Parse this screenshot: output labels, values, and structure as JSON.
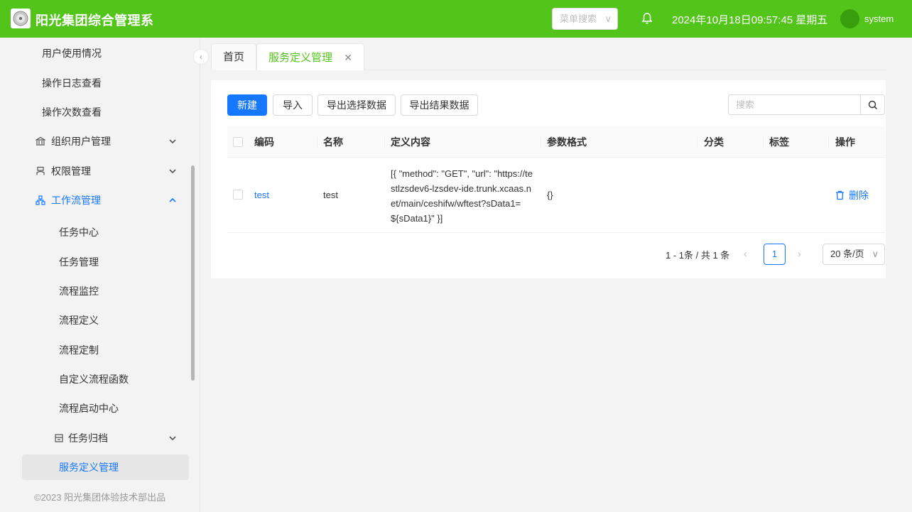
{
  "header": {
    "title": "阳光集团综合管理系",
    "menu_search_placeholder": "菜单搜索",
    "datetime": "2024年10月18日09:57:45 星期五",
    "username": "system",
    "accent": "#52c41a"
  },
  "sidebar": {
    "items": [
      {
        "label": "用户使用情况"
      },
      {
        "label": "操作日志查看"
      },
      {
        "label": "操作次数查看"
      },
      {
        "label": "组织用户管理",
        "icon": "bank-icon"
      },
      {
        "label": "权限管理",
        "icon": "user-icon"
      },
      {
        "label": "工作流管理",
        "icon": "cluster-icon"
      },
      {
        "label": "任务中心"
      },
      {
        "label": "任务管理"
      },
      {
        "label": "流程监控"
      },
      {
        "label": "流程定义"
      },
      {
        "label": "流程定制"
      },
      {
        "label": "自定义流程函数"
      },
      {
        "label": "流程启动中心"
      },
      {
        "label": "任务归档",
        "icon": "archive-icon"
      },
      {
        "label": "服务定义管理"
      }
    ],
    "copyright": "©2023 阳光集团体验技术部出品"
  },
  "tabs": [
    {
      "label": "首页"
    },
    {
      "label": "服务定义管理"
    }
  ],
  "toolbar": {
    "new_label": "新建",
    "import_label": "导入",
    "export_selected_label": "导出选择数据",
    "export_result_label": "导出结果数据",
    "search_placeholder": "搜索"
  },
  "table": {
    "columns": [
      "编码",
      "名称",
      "定义内容",
      "参数格式",
      "分类",
      "标签",
      "操作"
    ],
    "rows": [
      {
        "code": "test",
        "name": "test",
        "definition": "[{ \"method\": \"GET\", \"url\": \"https://testlzsdev6-lzsdev-ide.trunk.xcaas.net/main/ceshifw/wftest?sData1=${sData1}\" }]",
        "param_format": "{}",
        "category": "",
        "tag": "",
        "action": "删除"
      }
    ]
  },
  "pagination": {
    "summary": "1 - 1条 / 共 1 条",
    "current_page": "1",
    "page_size": "20 条/页"
  }
}
